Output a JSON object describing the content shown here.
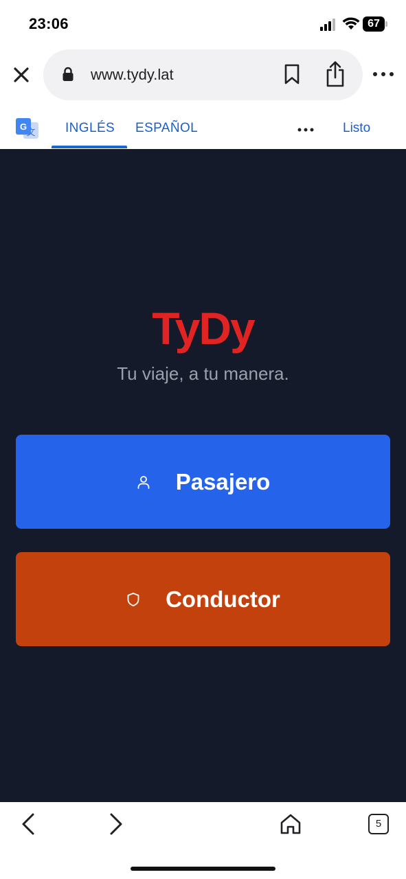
{
  "status_bar": {
    "time": "23:06",
    "battery": "67"
  },
  "browser": {
    "url": "www.tydy.lat",
    "icons": {
      "close": "close-icon",
      "lock": "lock-icon",
      "bookmark": "bookmark-icon",
      "share": "share-icon",
      "more": "more-icon"
    }
  },
  "translate_bar": {
    "tabs": [
      {
        "label": "INGLÉS",
        "active": true
      },
      {
        "label": "ESPAÑOL",
        "active": false
      }
    ],
    "done_label": "Listo",
    "accent_color": "#1a5fc8"
  },
  "page": {
    "brand": "TyDy",
    "brand_color": "#e02424",
    "tagline": "Tu viaje, a tu manera.",
    "background_color": "#141a29",
    "buttons": {
      "passenger": {
        "label": "Pasajero",
        "icon": "user-icon",
        "color": "#2563eb"
      },
      "driver": {
        "label": "Conductor",
        "icon": "shield-icon",
        "color": "#c2410c"
      }
    }
  },
  "bottom_bar": {
    "tab_count": "5"
  }
}
